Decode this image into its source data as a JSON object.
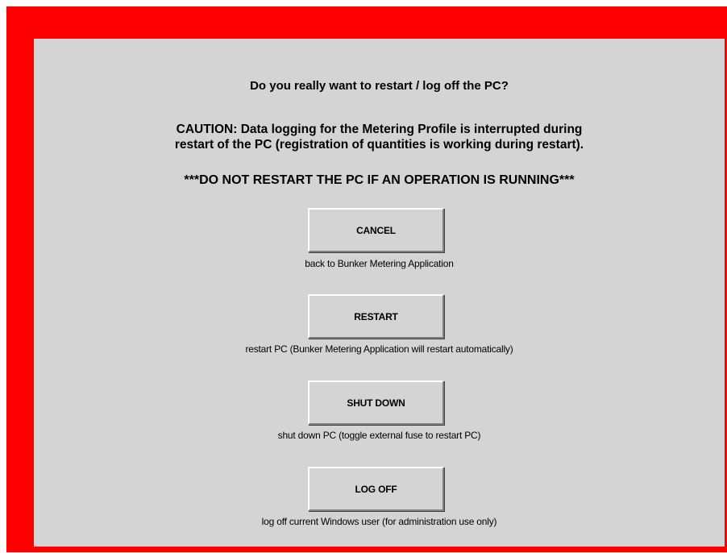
{
  "dialog": {
    "question": "Do you really want to restart / log off the PC?",
    "caution_line1": "CAUTION: Data logging for the Metering Profile is interrupted during",
    "caution_line2": "restart of the PC (registration of quantities is working during restart).",
    "warning": "***DO NOT RESTART THE PC IF AN OPERATION IS RUNNING***"
  },
  "buttons": [
    {
      "label": "CANCEL",
      "caption": "back to Bunker Metering Application"
    },
    {
      "label": "RESTART",
      "caption": "restart PC (Bunker Metering Application will restart automatically)"
    },
    {
      "label": "SHUT DOWN",
      "caption": "shut down PC (toggle external fuse to restart PC)"
    },
    {
      "label": "LOG OFF",
      "caption": "log off current Windows user (for administration use only)"
    }
  ],
  "colors": {
    "frame": "#ff0000",
    "panel": "#d4d4d4"
  }
}
